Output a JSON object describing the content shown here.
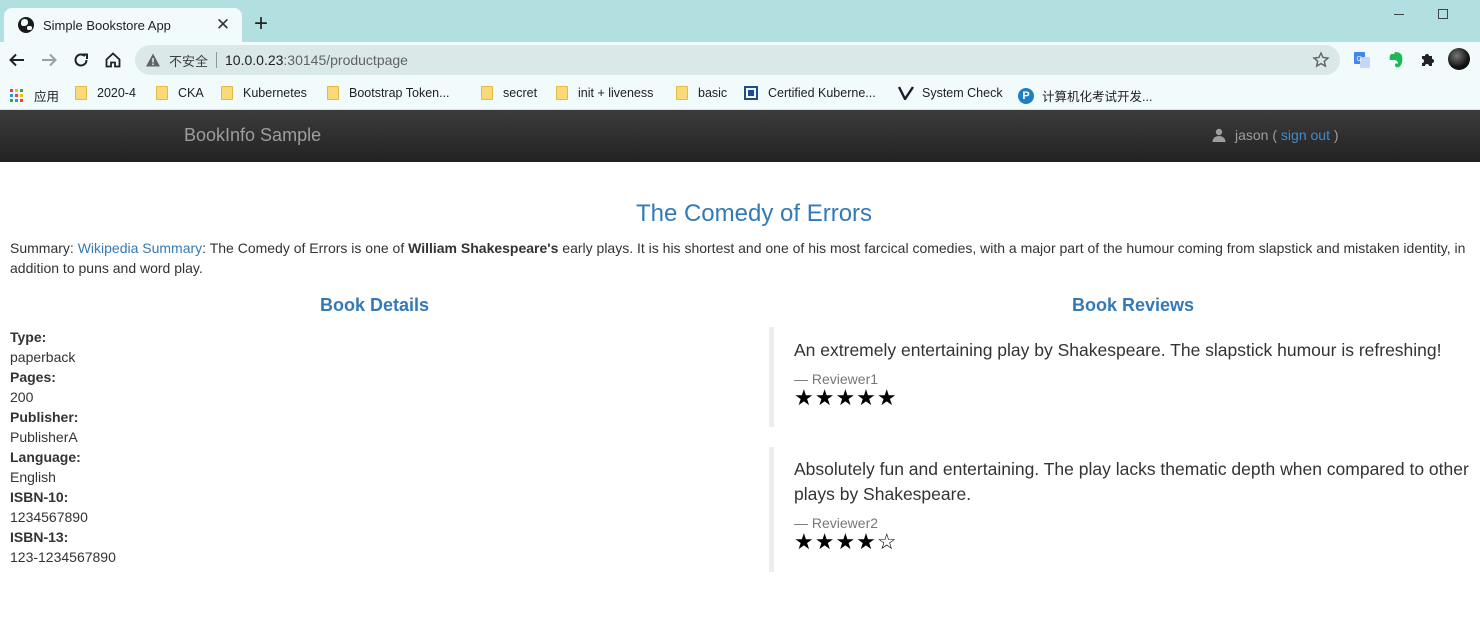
{
  "browser": {
    "tab_title": "Simple Bookstore App",
    "tab_close": "✕",
    "new_tab": "+",
    "insecure_label": "不安全",
    "url_host": "10.0.0.23",
    "url_rest": ":30145/productpage"
  },
  "bookmarks": {
    "items": [
      {
        "label": "应用",
        "icon": "apps-grid-icon"
      },
      {
        "label": "2020-4",
        "icon": "folder-icon"
      },
      {
        "label": "CKA",
        "icon": "folder-icon"
      },
      {
        "label": "Kubernetes",
        "icon": "folder-icon"
      },
      {
        "label": "Bootstrap Token...",
        "icon": "folder-icon"
      },
      {
        "label": "secret",
        "icon": "folder-icon"
      },
      {
        "label": "init + liveness",
        "icon": "folder-icon"
      },
      {
        "label": "basic",
        "icon": "folder-icon"
      },
      {
        "label": "Certified Kuberne...",
        "icon": "cncf-icon"
      },
      {
        "label": "System Check",
        "icon": "v-logo-icon"
      },
      {
        "label": "计算机化考试开发...",
        "icon": "p-logo-icon"
      }
    ]
  },
  "navbar": {
    "brand": "BookInfo Sample",
    "user": "jason",
    "open_paren": " ( ",
    "sign_out": "sign out",
    "close_paren": " )"
  },
  "book": {
    "title": "The Comedy of Errors",
    "summary_prefix": "Summary: ",
    "summary_link": "Wikipedia Summary",
    "summary_mid": ": The Comedy of Errors is one of ",
    "summary_bold": "William Shakespeare's",
    "summary_rest": " early plays. It is his shortest and one of his most farcical comedies, with a major part of the humour coming from slapstick and mistaken identity, in addition to puns and word play."
  },
  "details": {
    "heading": "Book Details",
    "type_label": "Type:",
    "type": "paperback",
    "pages_label": "Pages:",
    "pages": "200",
    "publisher_label": "Publisher:",
    "publisher": "PublisherA",
    "language_label": "Language:",
    "language": "English",
    "isbn10_label": "ISBN-10:",
    "isbn10": "1234567890",
    "isbn13_label": "ISBN-13:",
    "isbn13": "123-1234567890"
  },
  "reviews": {
    "heading": "Book Reviews",
    "items": [
      {
        "text": "An extremely entertaining play by Shakespeare. The slapstick humour is refreshing!",
        "reviewer": "— Reviewer1",
        "stars": "★★★★★",
        "rating": 5
      },
      {
        "text": "Absolutely fun and entertaining. The play lacks thematic depth when compared to other plays by Shakespeare.",
        "reviewer": "— Reviewer2",
        "stars": "★★★★☆",
        "rating": 4
      }
    ]
  }
}
